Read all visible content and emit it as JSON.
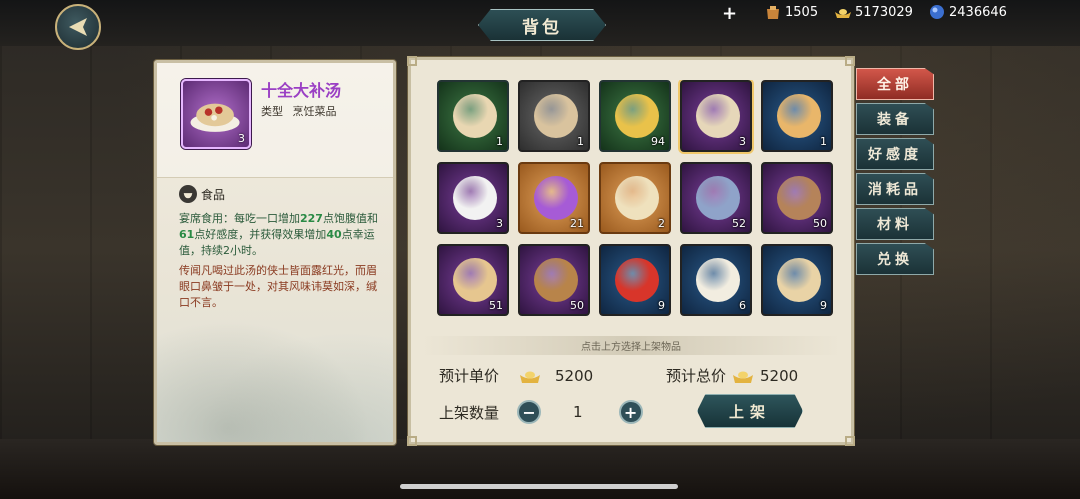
{
  "header": {
    "title": "背包"
  },
  "currencies": [
    {
      "icon": "pouch-icon",
      "value": "1505"
    },
    {
      "icon": "gold-ingot-icon",
      "value": "5173029"
    },
    {
      "icon": "jade-orb-icon",
      "value": "2436646"
    }
  ],
  "detail": {
    "name": "十全大补汤",
    "type_label": "类型",
    "type_value": "烹饪菜品",
    "count": "3",
    "tag": "食品",
    "effect_pre": "宴席食用：每吃一口增加",
    "effect_hl1": "227",
    "effect_mid1": "点饱腹值和",
    "effect_hl2": "61",
    "effect_mid2": "点好感度，并获得效果增加",
    "effect_hl3": "40",
    "effect_post": "点幸运值，持续2小时。",
    "lore": "传闻凡喝过此汤的侠士皆面露红光，而眉眼口鼻皱于一处，对其风味讳莫如深，缄口不言。"
  },
  "grid": {
    "items": [
      {
        "name": "medicine-jar-icon",
        "count": "1",
        "rarity": "green",
        "color": "#e9d7b2"
      },
      {
        "name": "medicine-bottle-icon",
        "count": "1",
        "rarity": "gray",
        "color": "#d9c39e"
      },
      {
        "name": "golden-leaf-icon",
        "count": "94",
        "rarity": "green",
        "color": "#e9c24a"
      },
      {
        "name": "tonic-soup-icon",
        "count": "3",
        "rarity": "purple",
        "color": "#e6d7b9"
      },
      {
        "name": "stew-pot-icon",
        "count": "1",
        "rarity": "blue",
        "color": "#e9b66a"
      },
      {
        "name": "porcelain-vase-icon",
        "count": "3",
        "rarity": "purple",
        "color": "#f2f2f2"
      },
      {
        "name": "purple-dragon-icon",
        "count": "21",
        "rarity": "orange",
        "color": "#a65bd6"
      },
      {
        "name": "scroll-letter-icon",
        "count": "2",
        "rarity": "orange",
        "color": "#efe1bd"
      },
      {
        "name": "lotus-flower-icon",
        "count": "52",
        "rarity": "purple",
        "color": "#8fa3c9"
      },
      {
        "name": "feathers-icon",
        "count": "50",
        "rarity": "purple",
        "color": "#b5835a"
      },
      {
        "name": "ginseng-root-icon",
        "count": "51",
        "rarity": "purple",
        "color": "#e6c68f"
      },
      {
        "name": "lingzhi-mushroom-icon",
        "count": "50",
        "rarity": "purple",
        "color": "#b8844a"
      },
      {
        "name": "red-chili-icon",
        "count": "9",
        "rarity": "blue",
        "color": "#d8352a"
      },
      {
        "name": "steamed-buns-icon",
        "count": "6",
        "rarity": "blue",
        "color": "#f2ede0"
      },
      {
        "name": "congee-bowl-icon",
        "count": "9",
        "rarity": "blue",
        "color": "#e9d3a6"
      }
    ],
    "hint": "点击上方选择上架物品"
  },
  "market": {
    "unit_price_label": "预计单价",
    "unit_price": "5200",
    "total_price_label": "预计总价",
    "total_price": "5200",
    "qty_label": "上架数量",
    "qty": "1",
    "minus": "−",
    "plus": "+",
    "list_button": "上架"
  },
  "tabs": [
    {
      "label": "全部",
      "active": true
    },
    {
      "label": "装备"
    },
    {
      "label": "好感度"
    },
    {
      "label": "消耗品"
    },
    {
      "label": "材料"
    },
    {
      "label": "兑换"
    }
  ],
  "colors": {
    "accent_red": "#c44a3c",
    "panel_teal": "#1f3a3f",
    "gold": "#e3b340",
    "item_name_purple": "#9a3fc4"
  }
}
